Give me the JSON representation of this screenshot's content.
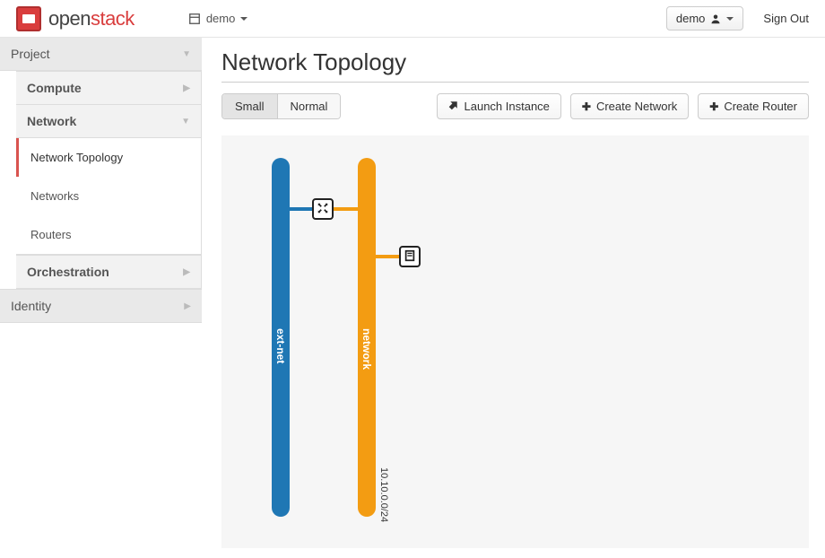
{
  "brand": {
    "name_plain": "open",
    "name_bold": "stack"
  },
  "header": {
    "project_label": "demo",
    "user_label": "demo",
    "signout_label": "Sign Out"
  },
  "sidebar": {
    "top": "Project",
    "compute": "Compute",
    "network": "Network",
    "network_items": [
      {
        "label": "Network Topology",
        "active": true
      },
      {
        "label": "Networks",
        "active": false
      },
      {
        "label": "Routers",
        "active": false
      }
    ],
    "orchestration": "Orchestration",
    "identity": "Identity"
  },
  "page": {
    "title": "Network Topology"
  },
  "viewmode": {
    "small": "Small",
    "normal": "Normal",
    "active": "small"
  },
  "actions": {
    "launch_instance": "Launch Instance",
    "create_network": "Create Network",
    "create_router": "Create Router"
  },
  "topology": {
    "networks": [
      {
        "id": "ext-net",
        "label": "ext-net",
        "color": "blue",
        "subnets": []
      },
      {
        "id": "network",
        "label": "network",
        "color": "orange",
        "subnets": [
          "10.10.0.0/24"
        ]
      }
    ],
    "router_node": {
      "connects": [
        "ext-net",
        "network"
      ]
    },
    "instance_node": {
      "connects": [
        "network"
      ]
    }
  }
}
